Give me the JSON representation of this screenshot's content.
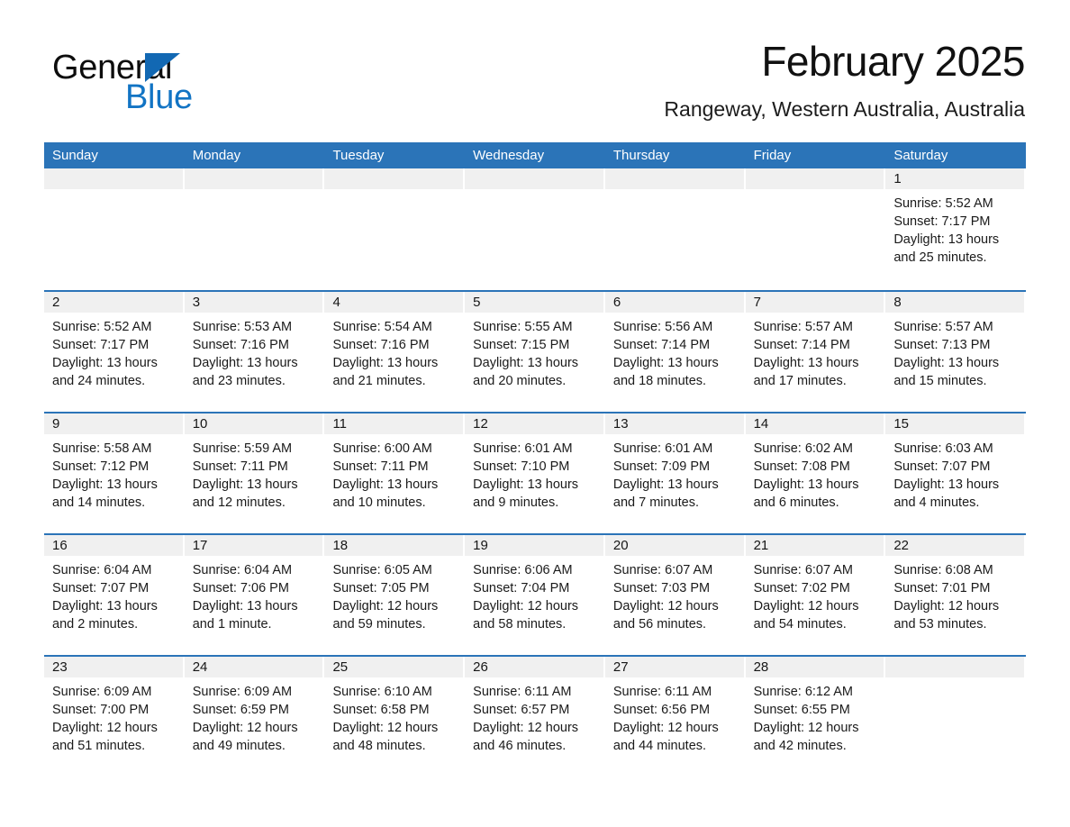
{
  "brand": {
    "name_part1": "General",
    "name_part2": "Blue",
    "triangle_icon": "triangle-icon",
    "accent_color": "#1268b3"
  },
  "header": {
    "month_title": "February 2025",
    "location": "Rangeway, Western Australia, Australia"
  },
  "theme": {
    "header_blue": "#2b74b8",
    "daynum_band_gray": "#f0f0f0",
    "text_color": "#1a1a1a"
  },
  "weekdays": [
    "Sunday",
    "Monday",
    "Tuesday",
    "Wednesday",
    "Thursday",
    "Friday",
    "Saturday"
  ],
  "weeks": [
    [
      {
        "day": "",
        "sunrise": "",
        "sunset": "",
        "daylight_line1": "",
        "daylight_line2": ""
      },
      {
        "day": "",
        "sunrise": "",
        "sunset": "",
        "daylight_line1": "",
        "daylight_line2": ""
      },
      {
        "day": "",
        "sunrise": "",
        "sunset": "",
        "daylight_line1": "",
        "daylight_line2": ""
      },
      {
        "day": "",
        "sunrise": "",
        "sunset": "",
        "daylight_line1": "",
        "daylight_line2": ""
      },
      {
        "day": "",
        "sunrise": "",
        "sunset": "",
        "daylight_line1": "",
        "daylight_line2": ""
      },
      {
        "day": "",
        "sunrise": "",
        "sunset": "",
        "daylight_line1": "",
        "daylight_line2": ""
      },
      {
        "day": "1",
        "sunrise": "Sunrise: 5:52 AM",
        "sunset": "Sunset: 7:17 PM",
        "daylight_line1": "Daylight: 13 hours",
        "daylight_line2": "and 25 minutes."
      }
    ],
    [
      {
        "day": "2",
        "sunrise": "Sunrise: 5:52 AM",
        "sunset": "Sunset: 7:17 PM",
        "daylight_line1": "Daylight: 13 hours",
        "daylight_line2": "and 24 minutes."
      },
      {
        "day": "3",
        "sunrise": "Sunrise: 5:53 AM",
        "sunset": "Sunset: 7:16 PM",
        "daylight_line1": "Daylight: 13 hours",
        "daylight_line2": "and 23 minutes."
      },
      {
        "day": "4",
        "sunrise": "Sunrise: 5:54 AM",
        "sunset": "Sunset: 7:16 PM",
        "daylight_line1": "Daylight: 13 hours",
        "daylight_line2": "and 21 minutes."
      },
      {
        "day": "5",
        "sunrise": "Sunrise: 5:55 AM",
        "sunset": "Sunset: 7:15 PM",
        "daylight_line1": "Daylight: 13 hours",
        "daylight_line2": "and 20 minutes."
      },
      {
        "day": "6",
        "sunrise": "Sunrise: 5:56 AM",
        "sunset": "Sunset: 7:14 PM",
        "daylight_line1": "Daylight: 13 hours",
        "daylight_line2": "and 18 minutes."
      },
      {
        "day": "7",
        "sunrise": "Sunrise: 5:57 AM",
        "sunset": "Sunset: 7:14 PM",
        "daylight_line1": "Daylight: 13 hours",
        "daylight_line2": "and 17 minutes."
      },
      {
        "day": "8",
        "sunrise": "Sunrise: 5:57 AM",
        "sunset": "Sunset: 7:13 PM",
        "daylight_line1": "Daylight: 13 hours",
        "daylight_line2": "and 15 minutes."
      }
    ],
    [
      {
        "day": "9",
        "sunrise": "Sunrise: 5:58 AM",
        "sunset": "Sunset: 7:12 PM",
        "daylight_line1": "Daylight: 13 hours",
        "daylight_line2": "and 14 minutes."
      },
      {
        "day": "10",
        "sunrise": "Sunrise: 5:59 AM",
        "sunset": "Sunset: 7:11 PM",
        "daylight_line1": "Daylight: 13 hours",
        "daylight_line2": "and 12 minutes."
      },
      {
        "day": "11",
        "sunrise": "Sunrise: 6:00 AM",
        "sunset": "Sunset: 7:11 PM",
        "daylight_line1": "Daylight: 13 hours",
        "daylight_line2": "and 10 minutes."
      },
      {
        "day": "12",
        "sunrise": "Sunrise: 6:01 AM",
        "sunset": "Sunset: 7:10 PM",
        "daylight_line1": "Daylight: 13 hours",
        "daylight_line2": "and 9 minutes."
      },
      {
        "day": "13",
        "sunrise": "Sunrise: 6:01 AM",
        "sunset": "Sunset: 7:09 PM",
        "daylight_line1": "Daylight: 13 hours",
        "daylight_line2": "and 7 minutes."
      },
      {
        "day": "14",
        "sunrise": "Sunrise: 6:02 AM",
        "sunset": "Sunset: 7:08 PM",
        "daylight_line1": "Daylight: 13 hours",
        "daylight_line2": "and 6 minutes."
      },
      {
        "day": "15",
        "sunrise": "Sunrise: 6:03 AM",
        "sunset": "Sunset: 7:07 PM",
        "daylight_line1": "Daylight: 13 hours",
        "daylight_line2": "and 4 minutes."
      }
    ],
    [
      {
        "day": "16",
        "sunrise": "Sunrise: 6:04 AM",
        "sunset": "Sunset: 7:07 PM",
        "daylight_line1": "Daylight: 13 hours",
        "daylight_line2": "and 2 minutes."
      },
      {
        "day": "17",
        "sunrise": "Sunrise: 6:04 AM",
        "sunset": "Sunset: 7:06 PM",
        "daylight_line1": "Daylight: 13 hours",
        "daylight_line2": "and 1 minute."
      },
      {
        "day": "18",
        "sunrise": "Sunrise: 6:05 AM",
        "sunset": "Sunset: 7:05 PM",
        "daylight_line1": "Daylight: 12 hours",
        "daylight_line2": "and 59 minutes."
      },
      {
        "day": "19",
        "sunrise": "Sunrise: 6:06 AM",
        "sunset": "Sunset: 7:04 PM",
        "daylight_line1": "Daylight: 12 hours",
        "daylight_line2": "and 58 minutes."
      },
      {
        "day": "20",
        "sunrise": "Sunrise: 6:07 AM",
        "sunset": "Sunset: 7:03 PM",
        "daylight_line1": "Daylight: 12 hours",
        "daylight_line2": "and 56 minutes."
      },
      {
        "day": "21",
        "sunrise": "Sunrise: 6:07 AM",
        "sunset": "Sunset: 7:02 PM",
        "daylight_line1": "Daylight: 12 hours",
        "daylight_line2": "and 54 minutes."
      },
      {
        "day": "22",
        "sunrise": "Sunrise: 6:08 AM",
        "sunset": "Sunset: 7:01 PM",
        "daylight_line1": "Daylight: 12 hours",
        "daylight_line2": "and 53 minutes."
      }
    ],
    [
      {
        "day": "23",
        "sunrise": "Sunrise: 6:09 AM",
        "sunset": "Sunset: 7:00 PM",
        "daylight_line1": "Daylight: 12 hours",
        "daylight_line2": "and 51 minutes."
      },
      {
        "day": "24",
        "sunrise": "Sunrise: 6:09 AM",
        "sunset": "Sunset: 6:59 PM",
        "daylight_line1": "Daylight: 12 hours",
        "daylight_line2": "and 49 minutes."
      },
      {
        "day": "25",
        "sunrise": "Sunrise: 6:10 AM",
        "sunset": "Sunset: 6:58 PM",
        "daylight_line1": "Daylight: 12 hours",
        "daylight_line2": "and 48 minutes."
      },
      {
        "day": "26",
        "sunrise": "Sunrise: 6:11 AM",
        "sunset": "Sunset: 6:57 PM",
        "daylight_line1": "Daylight: 12 hours",
        "daylight_line2": "and 46 minutes."
      },
      {
        "day": "27",
        "sunrise": "Sunrise: 6:11 AM",
        "sunset": "Sunset: 6:56 PM",
        "daylight_line1": "Daylight: 12 hours",
        "daylight_line2": "and 44 minutes."
      },
      {
        "day": "28",
        "sunrise": "Sunrise: 6:12 AM",
        "sunset": "Sunset: 6:55 PM",
        "daylight_line1": "Daylight: 12 hours",
        "daylight_line2": "and 42 minutes."
      },
      {
        "day": "",
        "sunrise": "",
        "sunset": "",
        "daylight_line1": "",
        "daylight_line2": ""
      }
    ]
  ]
}
